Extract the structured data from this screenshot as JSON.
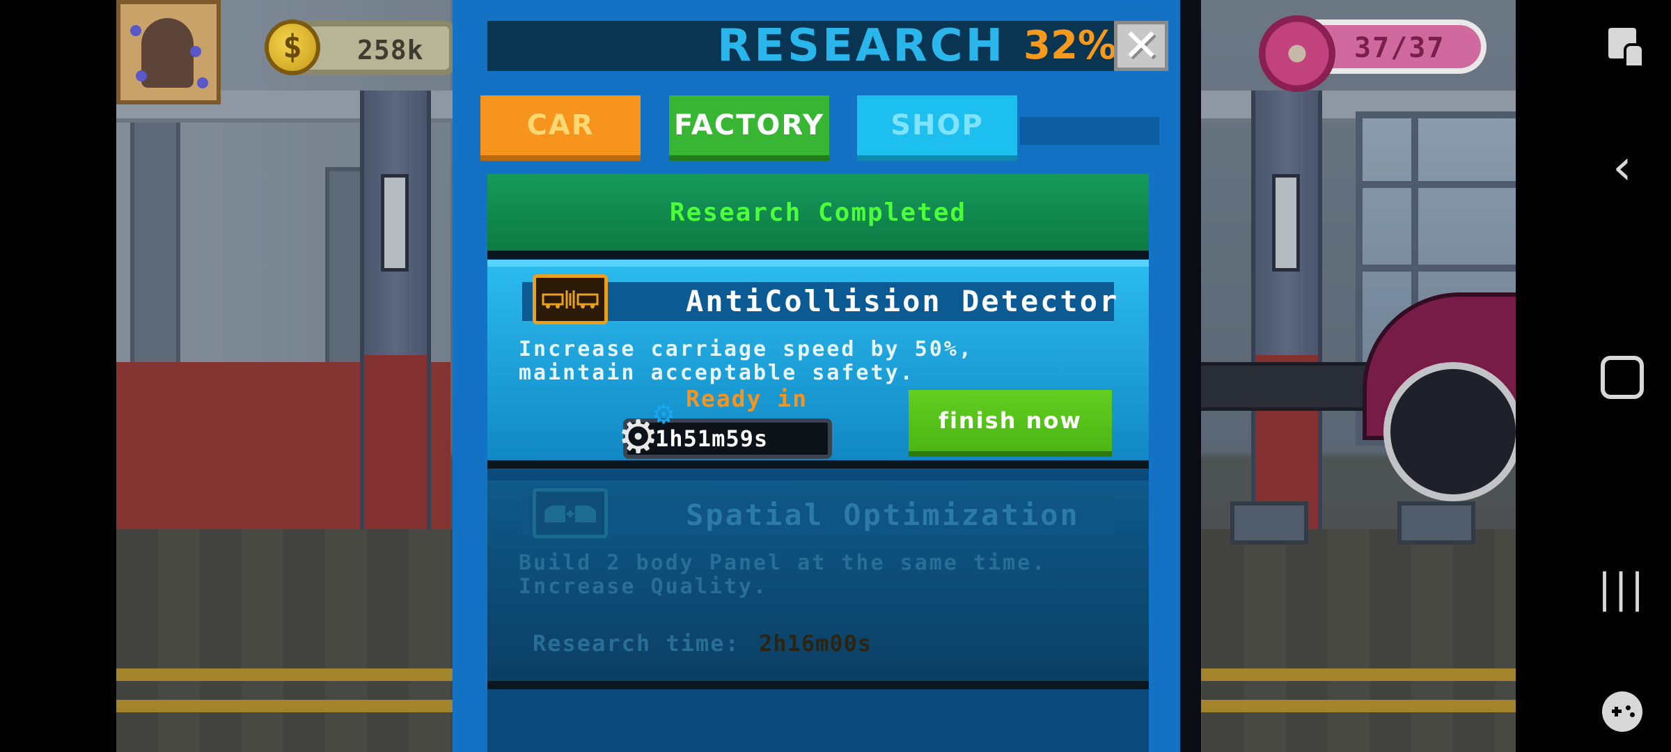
{
  "hud": {
    "coins": "258k",
    "coin_icon": "$",
    "donuts": "37/37"
  },
  "modal": {
    "title": "RESEARCH",
    "percent": "32%",
    "close_icon": "✕"
  },
  "tabs": [
    {
      "label": "CAR",
      "active": false
    },
    {
      "label": "FACTORY",
      "active": true
    },
    {
      "label": "SHOP",
      "active": false
    }
  ],
  "section_header": "Research Completed",
  "cards": [
    {
      "title": "AntiCollision Detector",
      "description_line1": "Increase carriage speed by 50%,",
      "description_line2": "maintain acceptable safety.",
      "ready_label": "Ready in",
      "timer": "1h51m59s",
      "action_label": "finish now",
      "icon": "collision-detector-icon"
    },
    {
      "title": "Spatial Optimization",
      "description_line1": "Build 2 body Panel at the same time.",
      "description_line2": "Increase Quality.",
      "time_label": "Research time:",
      "time_value": "2h16m00s",
      "icon": "spatial-optimization-icon",
      "locked": true
    }
  ],
  "system_nav": {
    "back_icon": "‹",
    "recent_icon": "|||"
  },
  "colors": {
    "modal_bg": "#1472c4",
    "title_text": "#2ab6ea",
    "percent_text": "#f79a1b",
    "tab_car": "#f7941d",
    "tab_factory": "#39b534",
    "tab_shop": "#1cbfee",
    "completed_text": "#4dff3a",
    "finish_button": "#4cb514"
  }
}
